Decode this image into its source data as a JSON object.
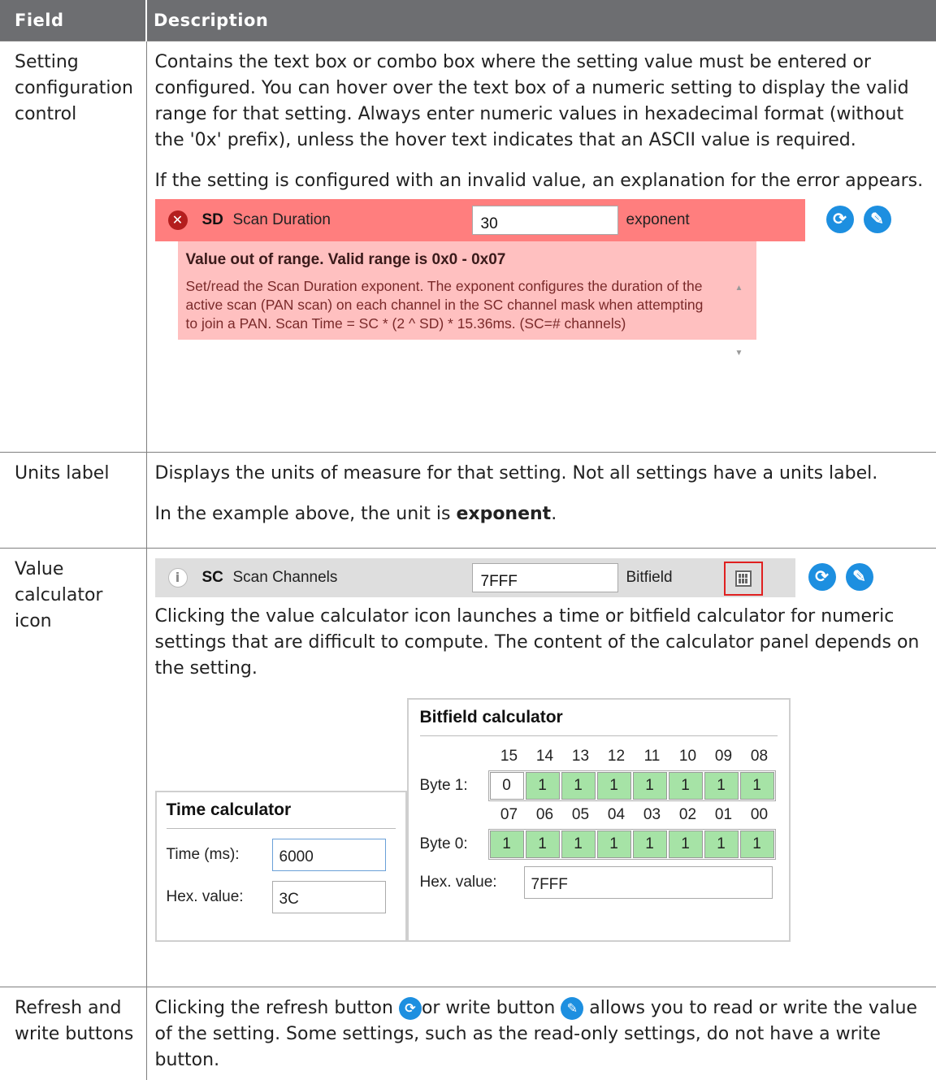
{
  "header": {
    "field": "Field",
    "description": "Description"
  },
  "row1": {
    "field": "Setting configuration control",
    "p1": "Contains the text box or combo box where the setting value must be entered or configured. You can hover over the text box of a numeric setting to display the valid range for that setting. Always enter numeric values in hexadecimal format (without the '0x' prefix), unless the hover text indicates that an ASCII value is required.",
    "p2": "If the setting is configured with an invalid value, an explanation for the error appears.",
    "setting": {
      "code": "SD",
      "name": "Scan Duration",
      "value": "30",
      "unit": "exponent"
    },
    "error_title": "Value out of range. Valid range is 0x0 - 0x07",
    "error_text": "Set/read the Scan Duration exponent. The exponent configures the duration of the active scan (PAN scan) on each channel in the SC channel mask when attempting to join a PAN. Scan Time = SC * (2 ^ SD) * 15.36ms. (SC=# channels)"
  },
  "row2": {
    "field": "Units label",
    "p1": "Displays the units of measure for that setting. Not all settings have a units label.",
    "p2_prefix": "In the example above, the unit is ",
    "p2_bold": "exponent",
    "p2_suffix": "."
  },
  "row3": {
    "field": "Value calculator icon",
    "setting": {
      "code": "SC",
      "name": "Scan Channels",
      "value": "7FFF",
      "unit": "Bitfield"
    },
    "p1": "Clicking the value calculator icon launches a time or bitfield calculator for numeric settings that are difficult to compute. The content of the calculator panel depends on the setting.",
    "bitfield": {
      "title": "Bitfield calculator",
      "byte1_label": "Byte 1:",
      "byte0_label": "Byte 0:",
      "byte1_positions": [
        "15",
        "14",
        "13",
        "12",
        "11",
        "10",
        "09",
        "08"
      ],
      "byte0_positions": [
        "07",
        "06",
        "05",
        "04",
        "03",
        "02",
        "01",
        "00"
      ],
      "byte1_bits": [
        "0",
        "1",
        "1",
        "1",
        "1",
        "1",
        "1",
        "1"
      ],
      "byte0_bits": [
        "1",
        "1",
        "1",
        "1",
        "1",
        "1",
        "1",
        "1"
      ],
      "hex_label": "Hex. value:",
      "hex_value": "7FFF"
    },
    "time": {
      "title": "Time calculator",
      "time_label": "Time (ms):",
      "time_value": "6000",
      "hex_label": "Hex. value:",
      "hex_value": "3C"
    }
  },
  "row4": {
    "field": "Refresh and write buttons",
    "t1": "Clicking the refresh button ",
    "t2": "or write button ",
    "t3": " allows you to read or write the value of the setting. Some settings, such as the read-only settings, do not have a write button."
  },
  "icons": {
    "error": "error-icon",
    "info": "info-icon",
    "refresh": "refresh-icon",
    "write": "write-icon",
    "calculator": "calculator-icon"
  },
  "colors": {
    "header_bg": "#6d6e71",
    "error_bg": "#ff7e7e",
    "error_panel": "#ffc0c0",
    "bit_on": "#a6e3a6",
    "button_blue": "#1d8fe0"
  }
}
